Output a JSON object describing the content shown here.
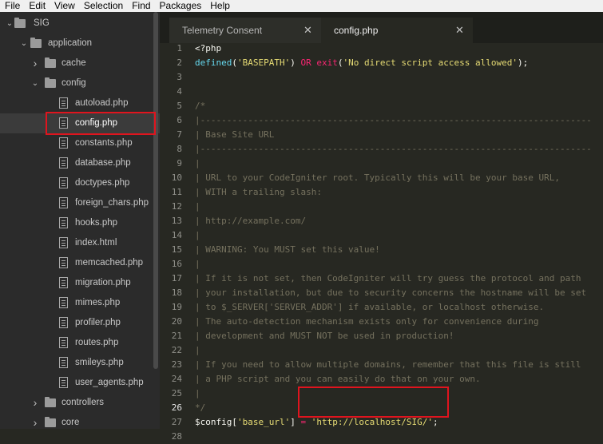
{
  "menubar": [
    "File",
    "Edit",
    "View",
    "Selection",
    "Find",
    "Packages",
    "Help"
  ],
  "sidebar": {
    "items": [
      {
        "label": "SIG",
        "type": "folder",
        "expanded": true,
        "depth": 0
      },
      {
        "label": "application",
        "type": "folder",
        "expanded": true,
        "depth": 1
      },
      {
        "label": "cache",
        "type": "folder",
        "expanded": false,
        "depth": 2
      },
      {
        "label": "config",
        "type": "folder",
        "expanded": true,
        "depth": 2
      },
      {
        "label": "autoload.php",
        "type": "file",
        "depth": 3
      },
      {
        "label": "config.php",
        "type": "file",
        "depth": 3,
        "selected": true
      },
      {
        "label": "constants.php",
        "type": "file",
        "depth": 3
      },
      {
        "label": "database.php",
        "type": "file",
        "depth": 3
      },
      {
        "label": "doctypes.php",
        "type": "file",
        "depth": 3
      },
      {
        "label": "foreign_chars.php",
        "type": "file",
        "depth": 3
      },
      {
        "label": "hooks.php",
        "type": "file",
        "depth": 3
      },
      {
        "label": "index.html",
        "type": "file",
        "depth": 3
      },
      {
        "label": "memcached.php",
        "type": "file",
        "depth": 3
      },
      {
        "label": "migration.php",
        "type": "file",
        "depth": 3
      },
      {
        "label": "mimes.php",
        "type": "file",
        "depth": 3
      },
      {
        "label": "profiler.php",
        "type": "file",
        "depth": 3
      },
      {
        "label": "routes.php",
        "type": "file",
        "depth": 3
      },
      {
        "label": "smileys.php",
        "type": "file",
        "depth": 3
      },
      {
        "label": "user_agents.php",
        "type": "file",
        "depth": 3
      },
      {
        "label": "controllers",
        "type": "folder",
        "expanded": false,
        "depth": 2
      },
      {
        "label": "core",
        "type": "folder",
        "expanded": false,
        "depth": 2
      }
    ]
  },
  "tabs": [
    {
      "label": "Telemetry Consent",
      "active": false
    },
    {
      "label": "config.php",
      "active": true
    }
  ],
  "editor": {
    "current_line": 26,
    "lines": [
      [
        [
          "pl",
          "<?php"
        ]
      ],
      [
        [
          "kw",
          "defined"
        ],
        [
          "pl",
          "("
        ],
        [
          "str",
          "'BASEPATH'"
        ],
        [
          "pl",
          ") "
        ],
        [
          "op",
          "OR"
        ],
        [
          "pl",
          " "
        ],
        [
          "op",
          "exit"
        ],
        [
          "pl",
          "("
        ],
        [
          "str",
          "'No direct script access allowed'"
        ],
        [
          "pl",
          ");"
        ]
      ],
      [],
      [],
      [
        [
          "cm",
          "/*"
        ]
      ],
      [
        [
          "cm",
          "|--------------------------------------------------------------------------"
        ]
      ],
      [
        [
          "cm",
          "| Base Site URL"
        ]
      ],
      [
        [
          "cm",
          "|--------------------------------------------------------------------------"
        ]
      ],
      [
        [
          "cm",
          "|"
        ]
      ],
      [
        [
          "cm",
          "| URL to your CodeIgniter root. Typically this will be your base URL,"
        ]
      ],
      [
        [
          "cm",
          "| WITH a trailing slash:"
        ]
      ],
      [
        [
          "cm",
          "|"
        ]
      ],
      [
        [
          "cm",
          "| http://example.com/"
        ]
      ],
      [
        [
          "cm",
          "|"
        ]
      ],
      [
        [
          "cm",
          "| WARNING: You MUST set this value!"
        ]
      ],
      [
        [
          "cm",
          "|"
        ]
      ],
      [
        [
          "cm",
          "| If it is not set, then CodeIgniter will try guess the protocol and path"
        ]
      ],
      [
        [
          "cm",
          "| your installation, but due to security concerns the hostname will be set"
        ]
      ],
      [
        [
          "cm",
          "| to $_SERVER['SERVER_ADDR'] if available, or localhost otherwise."
        ]
      ],
      [
        [
          "cm",
          "| The auto-detection mechanism exists only for convenience during"
        ]
      ],
      [
        [
          "cm",
          "| development and MUST NOT be used in production!"
        ]
      ],
      [
        [
          "cm",
          "|"
        ]
      ],
      [
        [
          "cm",
          "| If you need to allow multiple domains, remember that this file is still"
        ]
      ],
      [
        [
          "cm",
          "| a PHP script and you can easily do that on your own."
        ]
      ],
      [
        [
          "cm",
          "|"
        ]
      ],
      [
        [
          "cm",
          "*/"
        ]
      ],
      [
        [
          "pl",
          "$config["
        ],
        [
          "str",
          "'base_url'"
        ],
        [
          "pl",
          "] "
        ],
        [
          "op",
          "="
        ],
        [
          "pl",
          " "
        ],
        [
          "str",
          "'http://localhost/SIG/'"
        ],
        [
          "pl",
          ";"
        ]
      ],
      []
    ]
  },
  "colors": {
    "highlight": "#e0141e",
    "keyword": "#66d9ef",
    "string": "#e6db74",
    "operator": "#f92672",
    "comment": "#75715e"
  }
}
